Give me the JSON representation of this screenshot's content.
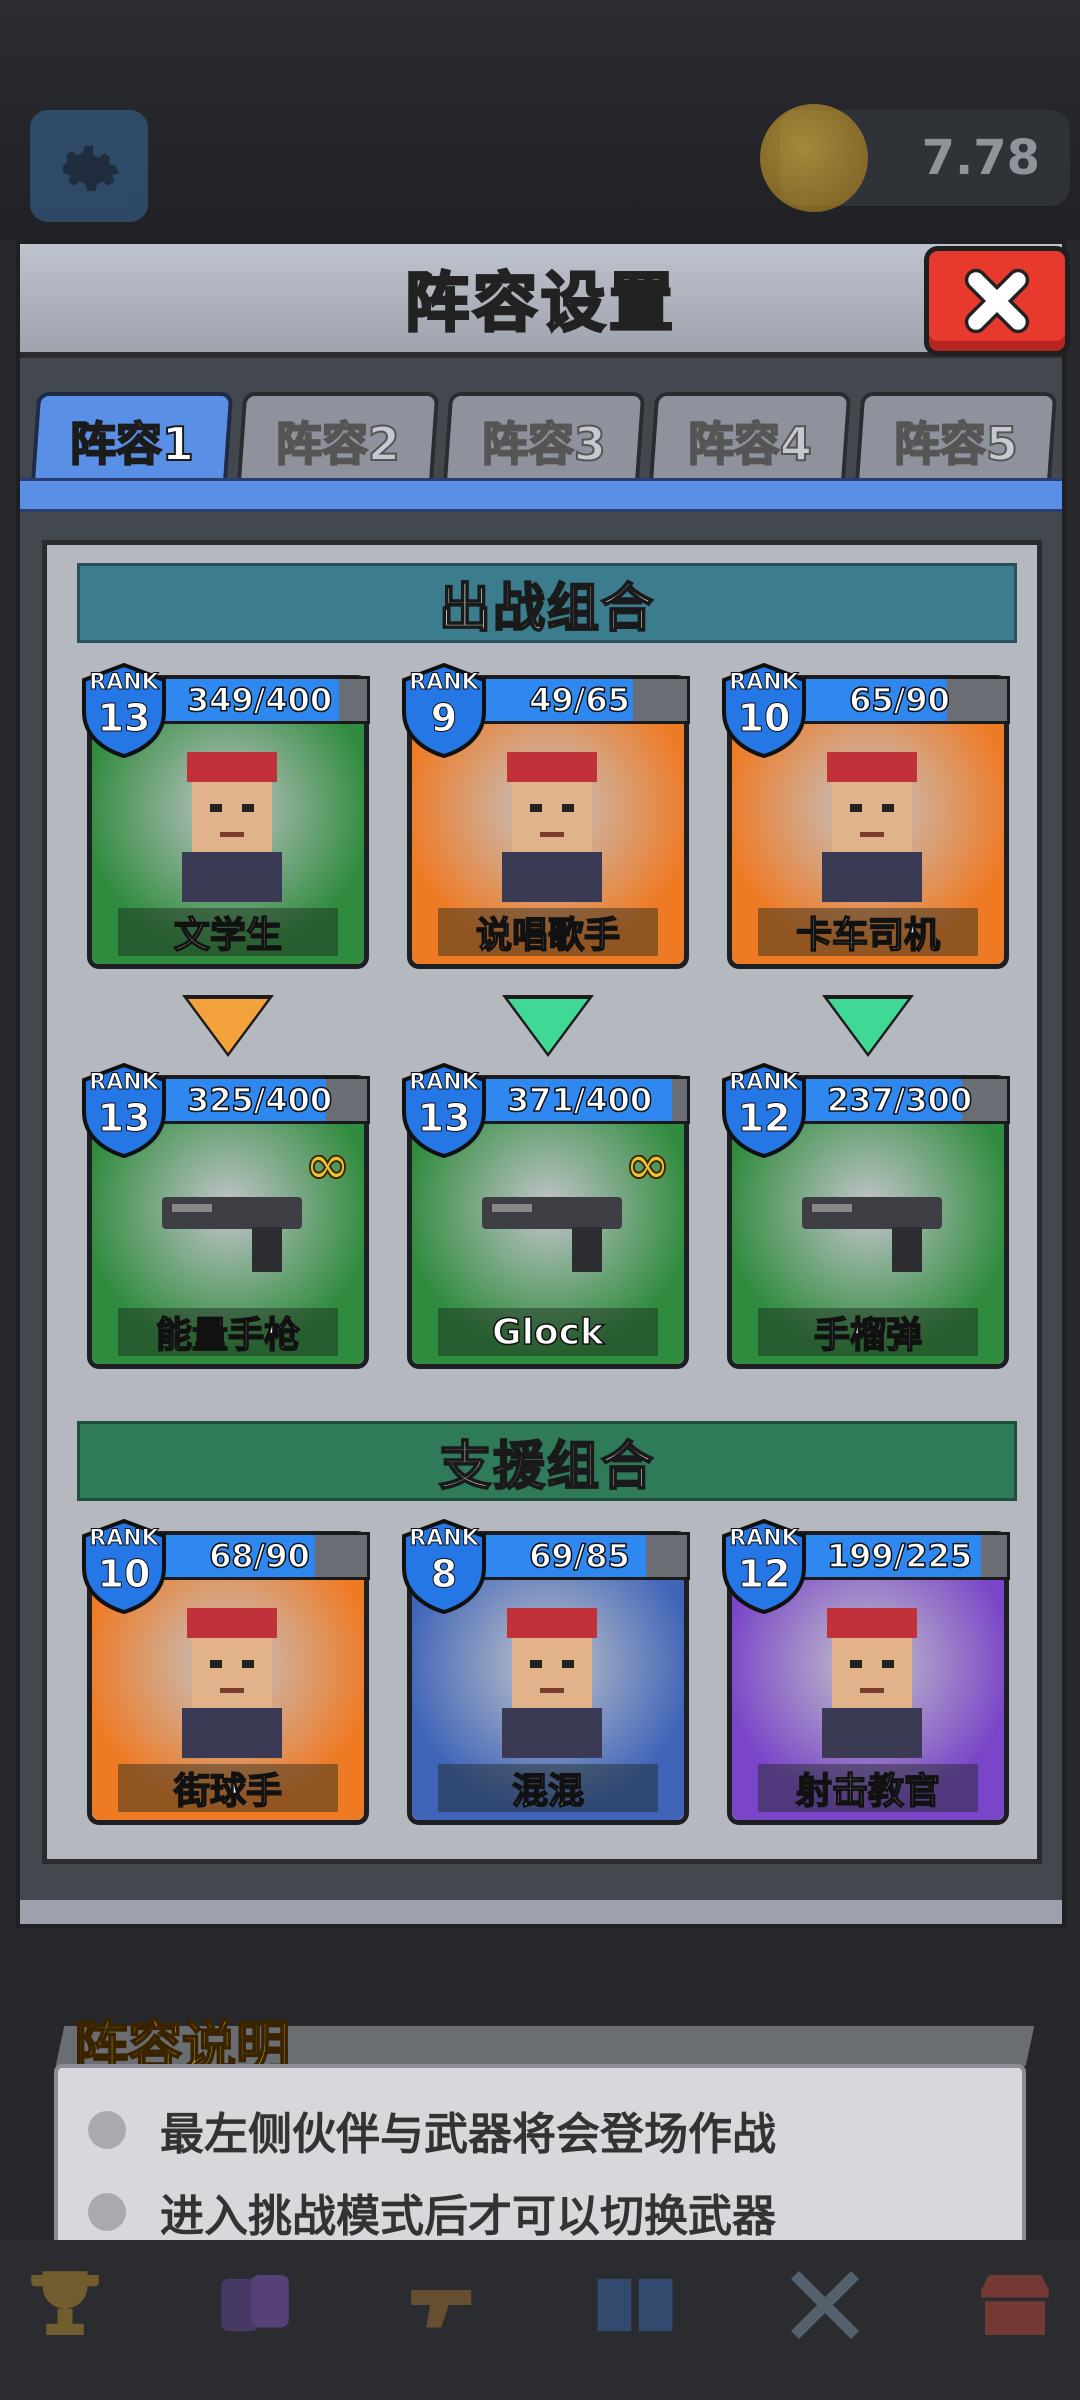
{
  "top": {
    "coins": "7.78"
  },
  "modal": {
    "title": "阵容设置",
    "tabs": [
      {
        "label": "阵容1",
        "active": true
      },
      {
        "label": "阵容2",
        "active": false
      },
      {
        "label": "阵容3",
        "active": false
      },
      {
        "label": "阵容4",
        "active": false
      },
      {
        "label": "阵容5",
        "active": false
      }
    ]
  },
  "battle": {
    "title": "出战组合",
    "companions": [
      {
        "rank_label": "RANK",
        "rank": "13",
        "progress": "349/400",
        "fill": 0.87,
        "name": "文学生",
        "color": "#2f8b3d"
      },
      {
        "rank_label": "RANK",
        "rank": "9",
        "progress": "49/65",
        "fill": 0.75,
        "name": "说唱歌手",
        "color": "#ef7a24"
      },
      {
        "rank_label": "RANK",
        "rank": "10",
        "progress": "65/90",
        "fill": 0.72,
        "name": "卡车司机",
        "color": "#ef7a24"
      }
    ],
    "weapons": [
      {
        "rank_label": "RANK",
        "rank": "13",
        "progress": "325/400",
        "fill": 0.81,
        "name": "能量手枪",
        "color": "#2f8b3d"
      },
      {
        "rank_label": "RANK",
        "rank": "13",
        "progress": "371/400",
        "fill": 0.93,
        "name": "Glock",
        "color": "#2f8b3d"
      },
      {
        "rank_label": "RANK",
        "rank": "12",
        "progress": "237/300",
        "fill": 0.79,
        "name": "手榴弹",
        "color": "#2f8b3d"
      }
    ]
  },
  "support": {
    "title": "支援组合",
    "companions": [
      {
        "rank_label": "RANK",
        "rank": "10",
        "progress": "68/90",
        "fill": 0.76,
        "name": "街球手",
        "color": "#ef7a24"
      },
      {
        "rank_label": "RANK",
        "rank": "8",
        "progress": "69/85",
        "fill": 0.81,
        "name": "混混",
        "color": "#3f64b8"
      },
      {
        "rank_label": "RANK",
        "rank": "12",
        "progress": "199/225",
        "fill": 0.88,
        "name": "射击教官",
        "color": "#7a45c8"
      }
    ]
  },
  "info": {
    "title": "阵容说明",
    "lines": [
      "最左侧伙伴与武器将会登场作战",
      "进入挑战模式后才可以切换武器"
    ]
  }
}
